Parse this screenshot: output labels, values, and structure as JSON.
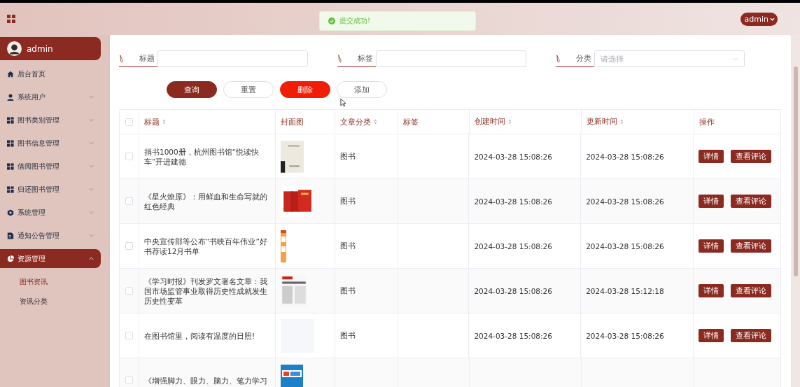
{
  "toast": {
    "message": "提交成功!"
  },
  "header": {
    "user_menu": "admin"
  },
  "sidebar": {
    "user": "admin",
    "items": [
      {
        "label": "后台首页",
        "selected": false
      },
      {
        "label": "系统用户",
        "selected": false,
        "expanded": false
      },
      {
        "label": "图书类别管理",
        "selected": false,
        "expanded": false
      },
      {
        "label": "图书信息管理",
        "selected": false,
        "expanded": false
      },
      {
        "label": "借阅图书管理",
        "selected": false,
        "expanded": false
      },
      {
        "label": "归还图书管理",
        "selected": false,
        "expanded": false
      },
      {
        "label": "系统管理",
        "selected": false,
        "expanded": false
      },
      {
        "label": "通知公告管理",
        "selected": false,
        "expanded": false
      },
      {
        "label": "资源管理",
        "selected": true,
        "expanded": true,
        "children": [
          {
            "label": "图书资讯",
            "selected": true
          },
          {
            "label": "资讯分类",
            "selected": false
          }
        ]
      }
    ]
  },
  "filters": [
    {
      "kind": "input",
      "label": "标题"
    },
    {
      "kind": "input",
      "label": "标签"
    },
    {
      "kind": "select",
      "label": "分类",
      "placeholder": "请选择"
    }
  ],
  "buttons": [
    {
      "kind": "primary",
      "label": "查询"
    },
    {
      "kind": "outline",
      "label": "重置"
    },
    {
      "kind": "danger",
      "label": "删除"
    },
    {
      "kind": "outline",
      "label": "添加"
    }
  ],
  "table": {
    "columns": [
      {
        "label": "标题",
        "sortable": true
      },
      {
        "label": "封面图",
        "sortable": false
      },
      {
        "label": "文章分类",
        "sortable": true
      },
      {
        "label": "标签",
        "sortable": false
      },
      {
        "label": "创建时间",
        "sortable": true
      },
      {
        "label": "更新时间",
        "sortable": true
      },
      {
        "label": "操作",
        "sortable": false
      }
    ],
    "select_all_checked": false,
    "rows": [
      {
        "checked": false,
        "title": "捐书1000册，杭州图书馆“悦读快车”开进建德",
        "cover": {
          "kind": "picture"
        },
        "category": "图书",
        "created": "2024-03-28 15:08:26",
        "updated": "2024-03-28 15:08:26",
        "actions": [
          "详情",
          "查看评论"
        ]
      },
      {
        "checked": false,
        "title": "《星火燎原》：用鲜血和生命写就的红色经典",
        "cover": {
          "kind": "picture"
        },
        "category": "图书",
        "created": "2024-03-28 15:08:26",
        "updated": "2024-03-28 15:08:26",
        "actions": [
          "详情",
          "查看评论"
        ]
      },
      {
        "checked": false,
        "title": "中央宣传部等公布“书映百年伟业”好书荐读12月书单",
        "cover": {
          "kind": "picture"
        },
        "category": "图书",
        "created": "2024-03-28 15:08:26",
        "updated": "2024-03-28 15:08:26",
        "actions": [
          "详情",
          "查看评论"
        ]
      },
      {
        "checked": false,
        "title": "《学习时报》刊发罗文署名文章：我国市场监管事业取得历史性成就发生历史性变革",
        "cover": {
          "kind": "picture"
        },
        "category": "图书",
        "created": "2024-03-28 15:08:26",
        "updated": "2024-03-28 15:12:18",
        "actions": [
          "详情",
          "查看评论"
        ]
      },
      {
        "checked": false,
        "title": "在图书馆里，阅读有温度的日照!",
        "cover": {
          "kind": "empty"
        },
        "category": "图书",
        "created": "2024-03-28 15:08:26",
        "updated": "2024-03-28 15:08:26",
        "actions": [
          "详情",
          "查看评论"
        ]
      },
      {
        "checked": false,
        "title": "《增强脚力、眼力、脑力、笔力学习",
        "cover": {
          "kind": "picture"
        }
      }
    ]
  }
}
